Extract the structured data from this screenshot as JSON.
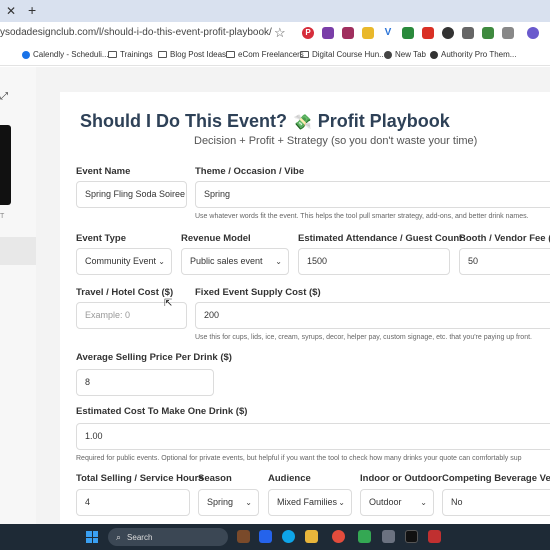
{
  "browser": {
    "url": "ysodadesignclub.com/l/should-i-do-this-event-profit-playbook/",
    "bookmarks": [
      "Calendly - Scheduli...",
      "Trainings",
      "Blog Post Ideas",
      "eCom Freelancers",
      "Digital Course Hun...",
      "New Tab",
      "Authority Pro Them..."
    ]
  },
  "form": {
    "title": "Should I Do This Event?",
    "title_suffix": "Profit Playbook",
    "subtitle": "Decision + Profit + Strategy (so you don't waste your time)",
    "event_name": {
      "label": "Event Name",
      "value": "Spring Fling Soda Soiree"
    },
    "theme": {
      "label": "Theme / Occasion / Vibe",
      "value": "Spring",
      "help": "Use whatever words fit the event. This helps the tool pull smarter strategy, add-ons, and better drink names."
    },
    "event_type": {
      "label": "Event Type",
      "value": "Community Event"
    },
    "revenue_model": {
      "label": "Revenue Model",
      "value": "Public sales event"
    },
    "attendance": {
      "label": "Estimated Attendance / Guest Count",
      "value": "1500"
    },
    "booth_fee": {
      "label": "Booth / Vendor Fee ($",
      "value": "50"
    },
    "travel_cost": {
      "label": "Travel / Hotel Cost ($)",
      "placeholder": "Example: 0"
    },
    "supply_cost": {
      "label": "Fixed Event Supply Cost ($)",
      "value": "200",
      "help": "Use this for cups, lids, ice, cream, syrups, decor, helper pay, custom signage, etc. that you're paying up front."
    },
    "avg_price": {
      "label": "Average Selling Price Per Drink ($)",
      "value": "8"
    },
    "cost_per_drink": {
      "label": "Estimated Cost To Make One Drink ($)",
      "value": "1.00",
      "help": "Required for public events. Optional for private events, but helpful if you want the tool to check how many drinks your quote can comfortably sup"
    },
    "hours": {
      "label": "Total Selling / Service Hours",
      "value": "4"
    },
    "season": {
      "label": "Season",
      "value": "Spring"
    },
    "audience": {
      "label": "Audience",
      "value": "Mixed Families"
    },
    "indoor_outdoor": {
      "label": "Indoor or Outdoor",
      "value": "Outdoor"
    },
    "competing": {
      "label": "Competing Beverage Vend",
      "value": "No"
    }
  },
  "left_panel": {
    "thumb_label": "T"
  },
  "taskbar": {
    "search_text": "Search"
  },
  "colors": {
    "title": "#2e4157",
    "taskbar": "#1e2a36",
    "tabstrip": "#d9e1ef",
    "accent_windows": "#3aa0f2"
  },
  "icons": [
    "close-icon",
    "plus-icon",
    "star-icon",
    "folder-icon",
    "money-icon",
    "chevron-down-icon",
    "search-icon",
    "windows-icon",
    "cursor-icon",
    "expand-icon"
  ]
}
